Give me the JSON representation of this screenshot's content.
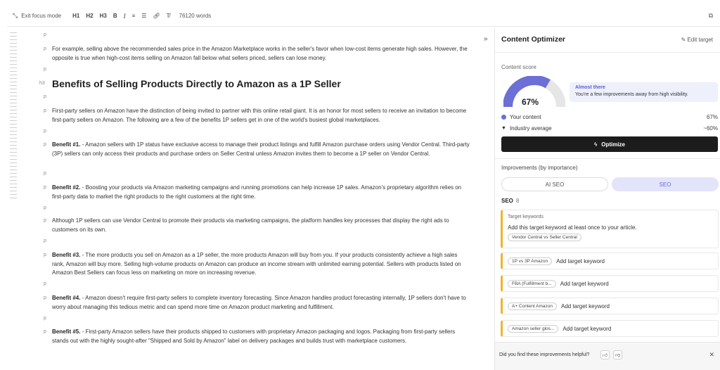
{
  "toolbar": {
    "exit_focus": "Exit focus mode",
    "h1": "H1",
    "h2": "H2",
    "h3": "H3",
    "bold": "B",
    "italic": "I",
    "word_count": "76120 words"
  },
  "editor": {
    "blocks": [
      {
        "tag": "p",
        "text": ""
      },
      {
        "tag": "p",
        "text": "For example, selling above the recommended sales price in the Amazon Marketplace works in the seller's favor when low-cost items generate high sales. However, the opposite is true when high-cost items selling on Amazon fall below what sellers priced, sellers can lose money."
      },
      {
        "tag": "p",
        "text": ""
      },
      {
        "tag": "h3",
        "text": "Benefits of Selling Products Directly to Amazon as a 1P Seller"
      },
      {
        "tag": "p",
        "text": ""
      },
      {
        "tag": "p",
        "text": "First-party sellers on Amazon have the distinction of being invited to partner with this online retail giant. It is an honor for most sellers to receive an invitation to become first-party sellers on Amazon. The following are a few of the benefits 1P sellers get in one of the world's busiest global marketplaces."
      },
      {
        "tag": "p",
        "text": ""
      },
      {
        "tag": "p",
        "bold": "Benefit #1.",
        "text": " - Amazon sellers with 1P status have exclusive access to manage their product listings and fulfill Amazon purchase orders using Vendor Central. Third-party (3P) sellers can only access their products and purchase orders on Seller Central unless Amazon invites them to become a 1P seller on Vendor Central."
      },
      {
        "tag": "p",
        "text": ""
      },
      {
        "tag": "p",
        "bold": "Benefit #2.",
        "text": " - Boosting your products via Amazon marketing campaigns and running promotions can help increase 1P sales. Amazon's proprietary algorithm relies on first-party data to market the right products to the right customers at the right time."
      },
      {
        "tag": "p",
        "text": ""
      },
      {
        "tag": "p",
        "text": "Although 1P sellers can use Vendor Central to promote their products via marketing campaigns, the platform handles key processes that display the right ads to customers on its own."
      },
      {
        "tag": "p",
        "text": ""
      },
      {
        "tag": "p",
        "bold": "Benefit #3.",
        "text": " - The more products you sell on Amazon as a 1P seller, the more products Amazon will buy from you. If your products consistently achieve a high sales rank, Amazon will buy more. Selling high-volume products on Amazon can produce an income stream with unlimited earning potential. Sellers with products listed on Amazon Best Sellers can focus less on marketing on more on increasing revenue."
      },
      {
        "tag": "p",
        "text": ""
      },
      {
        "tag": "p",
        "bold": "Benefit #4.",
        "text": " - Amazon doesn't require first-party sellers to complete inventory forecasting. Since Amazon handles product forecasting internally, 1P sellers don't have to worry about managing this tedious metric and can spend more time on Amazon product marketing and fulfillment."
      },
      {
        "tag": "p",
        "text": ""
      },
      {
        "tag": "p",
        "bold": "Benefit #5.",
        "text": " - First-party Amazon sellers have their products shipped to customers with proprietary Amazon packaging and logos. Packaging from first-party sellers stands out with the highly sought-after \"Shipped and Sold by Amazon\" label on delivery packages and builds trust with marketplace customers."
      }
    ]
  },
  "panel": {
    "title": "Content Optimizer",
    "edit_target": "Edit target",
    "content_score_label": "Content score",
    "score": 67,
    "score_text": "67%",
    "tip_title": "Almost there",
    "tip_text": "You're a few improvements away from high visibility.",
    "your_content_label": "Your content",
    "your_content_value": "67%",
    "industry_label": "Industry average",
    "industry_value": "~60%",
    "optimize_label": "Optimize",
    "improvements_label": "Improvements (by importance)",
    "tab_ai_seo": "AI SEO",
    "tab_seo": "SEO",
    "seo_heading": "SEO",
    "seo_count": "8",
    "target_keywords_title": "Target keywords",
    "target_keywords_text": "Add this target keyword at least once to your article.",
    "target_keywords_chip": "Vendor Central vs Seller Central",
    "keyword_items": [
      {
        "chip": "1P vs 3P Amazon",
        "action": "Add target keyword"
      },
      {
        "chip": "FBA (Fulfillment b...",
        "action": "Add target keyword"
      },
      {
        "chip": "A+ Content Amazon",
        "action": "Add target keyword"
      },
      {
        "chip": "Amazon seller glos...",
        "action": "Add target keyword"
      }
    ],
    "feedback_text": "Did you find these improvements helpful?",
    "colors": {
      "accent": "#6b6fd6",
      "warning": "#f0b429",
      "dark": "#1c1c1c"
    }
  }
}
